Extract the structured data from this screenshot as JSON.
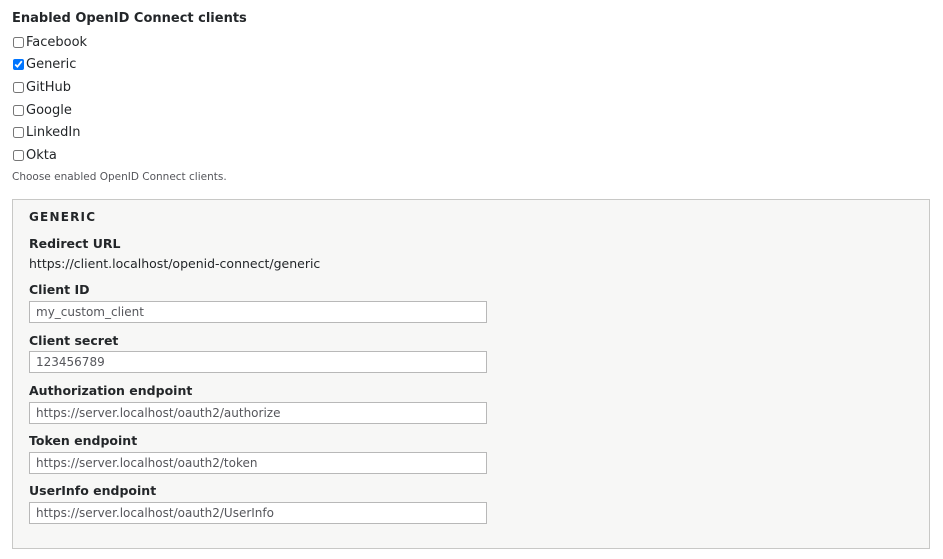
{
  "clients": {
    "title": "Enabled OpenID Connect clients",
    "options": [
      {
        "label": "Facebook",
        "checked": false
      },
      {
        "label": "Generic",
        "checked": true
      },
      {
        "label": "GitHub",
        "checked": false
      },
      {
        "label": "Google",
        "checked": false
      },
      {
        "label": "LinkedIn",
        "checked": false
      },
      {
        "label": "Okta",
        "checked": false
      }
    ],
    "description": "Choose enabled OpenID Connect clients."
  },
  "generic": {
    "legend": "GENERIC",
    "redirect_url_label": "Redirect URL",
    "redirect_url_value": "https://client.localhost/openid-connect/generic",
    "client_id_label": "Client ID",
    "client_id_value": "my_custom_client",
    "client_secret_label": "Client secret",
    "client_secret_value": "123456789",
    "authorization_endpoint_label": "Authorization endpoint",
    "authorization_endpoint_value": "https://server.localhost/oauth2/authorize",
    "token_endpoint_label": "Token endpoint",
    "token_endpoint_value": "https://server.localhost/oauth2/token",
    "userinfo_endpoint_label": "UserInfo endpoint",
    "userinfo_endpoint_value": "https://server.localhost/oauth2/UserInfo"
  }
}
